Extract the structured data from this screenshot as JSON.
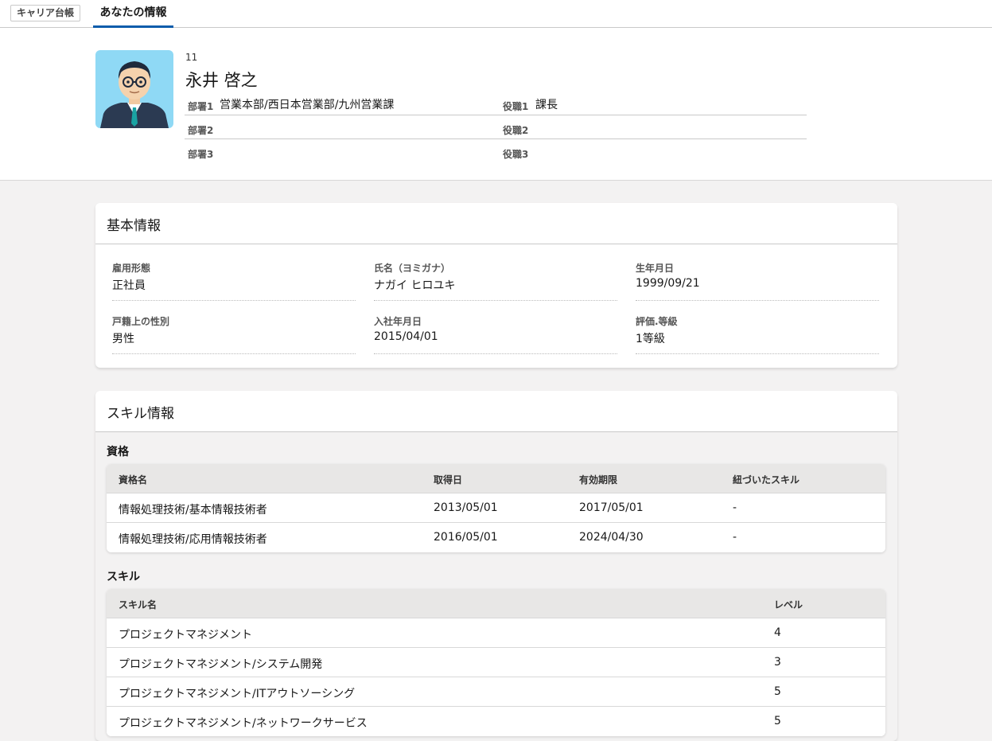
{
  "tabs": {
    "career_ledger": "キャリア台帳",
    "your_info": "あなたの情報"
  },
  "profile": {
    "id": "11",
    "name": "永井 啓之",
    "dept1_label": "部署1",
    "dept1_value": "営業本部/西日本営業部/九州営業課",
    "role1_label": "役職1",
    "role1_value": "課長",
    "dept2_label": "部署2",
    "dept2_value": "",
    "role2_label": "役職2",
    "role2_value": "",
    "dept3_label": "部署3",
    "dept3_value": "",
    "role3_label": "役職3",
    "role3_value": ""
  },
  "basic": {
    "title": "基本情報",
    "fields": [
      {
        "label": "雇用形態",
        "value": "正社員"
      },
      {
        "label": "氏名（ヨミガナ）",
        "value": "ナガイ ヒロユキ"
      },
      {
        "label": "生年月日",
        "value": "1999/09/21"
      },
      {
        "label": "戸籍上の性別",
        "value": "男性"
      },
      {
        "label": "入社年月日",
        "value": "2015/04/01"
      },
      {
        "label": "評価.等級",
        "value": "1等級"
      }
    ]
  },
  "skills": {
    "title": "スキル情報",
    "qualifications": {
      "title": "資格",
      "columns": [
        "資格名",
        "取得日",
        "有効期限",
        "紐づいたスキル"
      ],
      "rows": [
        [
          "情報処理技術/基本情報技術者",
          "2013/05/01",
          "2017/05/01",
          "-"
        ],
        [
          "情報処理技術/応用情報技術者",
          "2016/05/01",
          "2024/04/30",
          "-"
        ]
      ]
    },
    "skill_list": {
      "title": "スキル",
      "columns": [
        "スキル名",
        "レベル"
      ],
      "rows": [
        [
          "プロジェクトマネジメント",
          "4"
        ],
        [
          "プロジェクトマネジメント/システム開発",
          "3"
        ],
        [
          "プロジェクトマネジメント/ITアウトソーシング",
          "5"
        ],
        [
          "プロジェクトマネジメント/ネットワークサービス",
          "5"
        ]
      ]
    }
  }
}
